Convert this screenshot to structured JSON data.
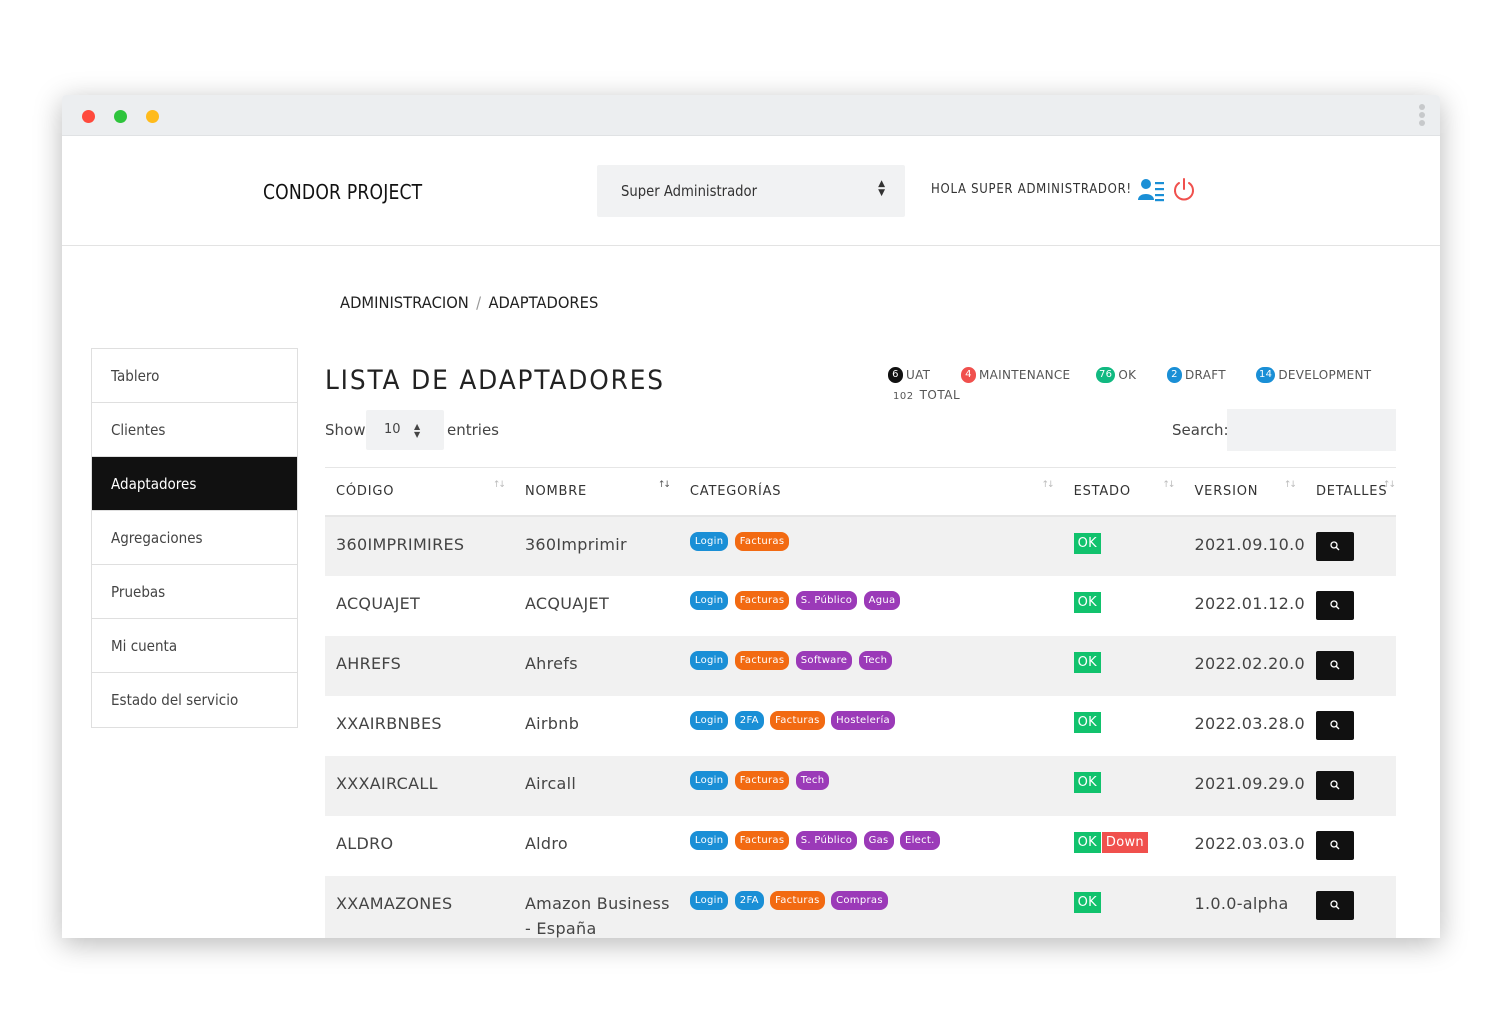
{
  "brand": "CONDOR PROJECT",
  "role_select": {
    "value": "Super Administrador"
  },
  "greeting": "HOLA SUPER ADMINISTRADOR!",
  "breadcrumb": {
    "parent": "ADMINISTRACION",
    "sep": "/",
    "current": "ADAPTADORES"
  },
  "sidebar": {
    "items": [
      {
        "label": "Tablero",
        "active": false
      },
      {
        "label": "Clientes",
        "active": false
      },
      {
        "label": "Adaptadores",
        "active": true
      },
      {
        "label": "Agregaciones",
        "active": false
      },
      {
        "label": "Pruebas",
        "active": false
      },
      {
        "label": "Mi cuenta",
        "active": false
      },
      {
        "label": "Estado del servicio",
        "active": false
      }
    ]
  },
  "page_title": "LISTA DE ADAPTADORES",
  "stats": [
    {
      "count": "6",
      "label": "UAT",
      "color": "#111111"
    },
    {
      "count": "4",
      "label": "MAINTENANCE",
      "color": "#f0504d"
    },
    {
      "count": "76",
      "label": "OK",
      "color": "#11b981"
    },
    {
      "count": "2",
      "label": "DRAFT",
      "color": "#1a8fd6"
    },
    {
      "count": "14",
      "label": "DEVELOPMENT",
      "color": "#1a8fd6"
    }
  ],
  "total": {
    "count": "102",
    "label": "TOTAL"
  },
  "length": {
    "show": "Show",
    "value": "10",
    "entries": "entries"
  },
  "search": {
    "label": "Search:",
    "value": ""
  },
  "table": {
    "headers": [
      "CÓDIGO",
      "NOMBRE",
      "CATEGORÍAS",
      "ESTADO",
      "VERSION",
      "DETALLES"
    ],
    "rows": [
      {
        "codigo": "360IMPRIMIRES",
        "nombre": "360Imprimir",
        "categorias": [
          "Login",
          "Facturas"
        ],
        "estado": [
          "OK"
        ],
        "version": "2021.09.10.0"
      },
      {
        "codigo": "ACQUAJET",
        "nombre": "ACQUAJET",
        "categorias": [
          "Login",
          "Facturas",
          "S. Público",
          "Agua"
        ],
        "estado": [
          "OK"
        ],
        "version": "2022.01.12.0"
      },
      {
        "codigo": "AHREFS",
        "nombre": "Ahrefs",
        "categorias": [
          "Login",
          "Facturas",
          "Software",
          "Tech"
        ],
        "estado": [
          "OK"
        ],
        "version": "2022.02.20.0"
      },
      {
        "codigo": "XXAIRBNBES",
        "nombre": "Airbnb",
        "categorias": [
          "Login",
          "2FA",
          "Facturas",
          "Hostelería"
        ],
        "estado": [
          "OK"
        ],
        "version": "2022.03.28.0"
      },
      {
        "codigo": "XXXAIRCALL",
        "nombre": "Aircall",
        "categorias": [
          "Login",
          "Facturas",
          "Tech"
        ],
        "estado": [
          "OK"
        ],
        "version": "2021.09.29.0"
      },
      {
        "codigo": "ALDRO",
        "nombre": "Aldro",
        "categorias": [
          "Login",
          "Facturas",
          "S. Público",
          "Gas",
          "Elect."
        ],
        "estado": [
          "OK",
          "Down"
        ],
        "version": "2022.03.03.0"
      },
      {
        "codigo": "XXAMAZONES",
        "nombre": "Amazon Business - España",
        "categorias": [
          "Login",
          "2FA",
          "Facturas",
          "Compras"
        ],
        "estado": [
          "OK"
        ],
        "version": "1.0.0-alpha"
      }
    ]
  },
  "colors": {
    "Login": "#1a8fd6",
    "2FA": "#1a8fd6",
    "Facturas": "#f26a12",
    "S. Público": "#9b3ab8",
    "Agua": "#9b3ab8",
    "Software": "#9b3ab8",
    "Tech": "#9b3ab8",
    "Hostelería": "#9b3ab8",
    "Gas": "#9b3ab8",
    "Elect.": "#9b3ab8",
    "Compras": "#9b3ab8",
    "OK": "#11c26d",
    "Down": "#f0504d"
  },
  "icons": {
    "user": "user-list-icon",
    "power": "power-icon",
    "detail": "search-icon"
  }
}
